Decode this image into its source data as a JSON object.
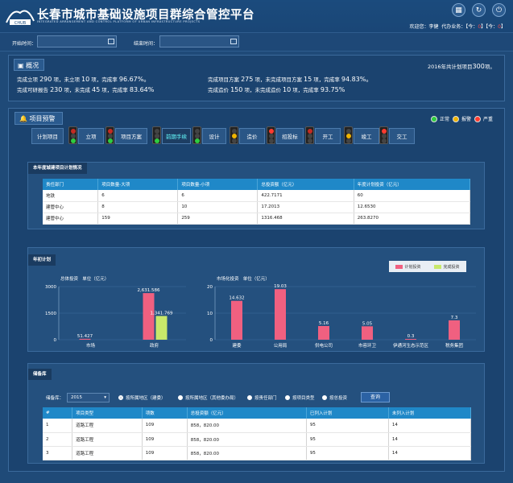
{
  "header": {
    "title": "长春市城市基础设施项目群综合管控平台",
    "subtitle": "INTEGRATED ARRANGEMENT AND CONTROL PLATFORM OF URBAN INFRASTRUCTURE PROJECTS",
    "logo_text": "CHUB",
    "user_label": "欢迎您：李健",
    "todo_label": "代办业务：【今：",
    "todo_today": "0",
    "todo_mid": "】【今：",
    "todo_other": "0",
    "todo_end": "】"
  },
  "filter": {
    "start_label": "开始时间：",
    "end_label": "结束时间："
  },
  "overview": {
    "title": "概况",
    "plan_year_text": "2016年共计划项目",
    "plan_year_count": "300",
    "plan_year_unit": "项。",
    "l1": "完成立项",
    "l1v": "290",
    "l1b": "项，未立项",
    "l1w": "10",
    "l1c": "项，完成率",
    "l1r": "96.67%。",
    "l2": "完成可研报告",
    "l2v": "230",
    "l2b": "项，未完成",
    "l2w": "45",
    "l2c": "项，完成率",
    "l2r": "83.64%",
    "r1": "完成项目方案",
    "r1v": "275",
    "r1b": "项，未完成项目方案",
    "r1w": "15",
    "r1c": "项，完成率",
    "r1r": "94.83%。",
    "r2": "完成造价",
    "r2v": "150",
    "r2b": "项，未完成造价",
    "r2w": "10",
    "r2c": "项，完成率",
    "r2r": "93.75%"
  },
  "warning": {
    "title": "项目预警",
    "legend": [
      {
        "label": "正常",
        "color": "#2ecc40"
      },
      {
        "label": "报警",
        "color": "#f0b400"
      },
      {
        "label": "严重",
        "color": "#ff3b2f"
      }
    ],
    "tabs": [
      "计划项目",
      "立项",
      "项目方案",
      "前期手续",
      "设计",
      "造价",
      "招投标",
      "开工",
      "竣工",
      "交工"
    ],
    "active_tab": "前期手续"
  },
  "plan_table": {
    "label": "本年度城建项目计划情况",
    "headers": [
      "责任部门",
      "项目数量-大项",
      "项目数量-小项",
      "总投资额（亿元）",
      "年度计划投资（亿元）"
    ],
    "rows": [
      [
        "地铁",
        "6",
        "6",
        "422.7171",
        "60"
      ],
      [
        "建管中心",
        "8",
        "10",
        "17.2013",
        "12.6530"
      ],
      [
        "建管中心",
        "159",
        "259",
        "1316.468",
        "263.8270"
      ]
    ]
  },
  "annual": {
    "label": "年初计划",
    "legend_plan": "计划投资",
    "legend_done": "完成投资",
    "left_sub": "总体投资",
    "left_unit": "单位（亿元）",
    "right_sub": "市场化投资",
    "right_unit": "单位（亿元）"
  },
  "chart_data": [
    {
      "type": "bar",
      "categories": [
        "市场",
        "政府"
      ],
      "series": [
        {
          "name": "计划投资",
          "values": [
            51.427,
            2631.586
          ]
        },
        {
          "name": "完成投资",
          "values": [
            0,
            1341.769
          ]
        }
      ],
      "ylim": [
        0,
        3000
      ],
      "yticks": [
        0,
        1500,
        3000
      ],
      "colors": [
        "#f06080",
        "#c8e86a"
      ]
    },
    {
      "type": "bar",
      "categories": [
        "建委",
        "公用局",
        "供电公司",
        "市容环卫",
        "伊通河生态示范区",
        "税务集团"
      ],
      "series": [
        {
          "name": "计划投资",
          "values": [
            14.632,
            19.03,
            5.16,
            5.05,
            0.3,
            7.3
          ]
        }
      ],
      "ylim": [
        0,
        20
      ],
      "yticks": [
        0,
        10,
        20
      ],
      "colors": [
        "#f06080"
      ]
    }
  ],
  "reserve": {
    "label": "储备库",
    "year_label": "储备库：",
    "year_value": "2015",
    "options": [
      "按所属地区（建委）",
      "按所属地区（其他委办局）",
      "按责任部门",
      "按项目类型",
      "按总投资"
    ],
    "query": "查询",
    "headers": [
      "#",
      "项目类型",
      "项数",
      "总投资额（亿元）",
      "已列入计划",
      "未列入计划"
    ],
    "rows": [
      [
        "1",
        "道路工程",
        "109",
        "858，820.00",
        "95",
        "14"
      ],
      [
        "2",
        "道路工程",
        "109",
        "858，820.00",
        "95",
        "14"
      ],
      [
        "3",
        "道路工程",
        "109",
        "858，820.00",
        "95",
        "14"
      ]
    ]
  }
}
